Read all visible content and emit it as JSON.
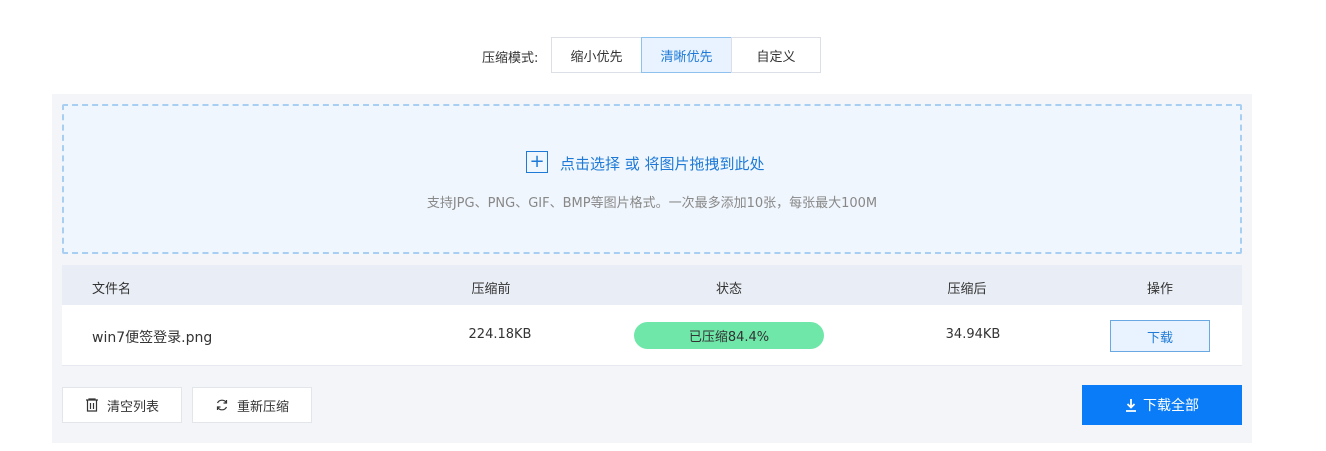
{
  "mode": {
    "label": "压缩模式:",
    "options": [
      "缩小优先",
      "清晰优先",
      "自定义"
    ],
    "selected": "清晰优先"
  },
  "dropzone": {
    "title": "点击选择 或 将图片拖拽到此处",
    "hint": "支持JPG、PNG、GIF、BMP等图片格式。一次最多添加10张，每张最大100M"
  },
  "table": {
    "headers": [
      "文件名",
      "压缩前",
      "状态",
      "压缩后",
      "操作"
    ],
    "rows": [
      {
        "name": "win7便签登录.png",
        "before": "224.18KB",
        "status": "已压缩84.4%",
        "after": "34.94KB",
        "action": "下载"
      }
    ]
  },
  "actions": {
    "clear": "清空列表",
    "recompress": "重新压缩",
    "download_all": "下载全部"
  },
  "colors": {
    "accent": "#0a7cf8",
    "success": "#6ee7a9"
  }
}
